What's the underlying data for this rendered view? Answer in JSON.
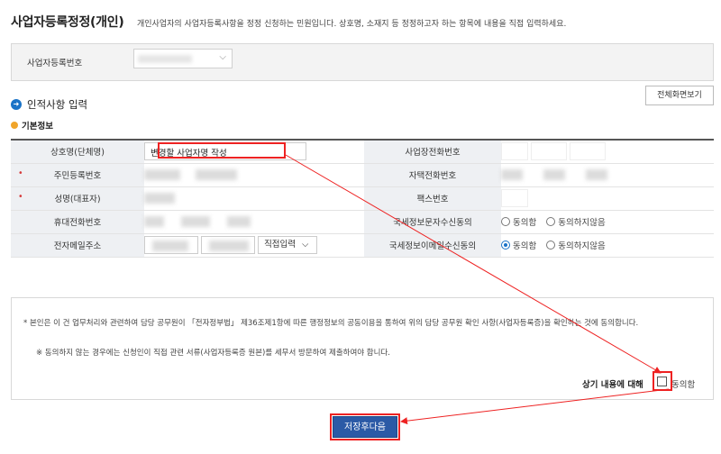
{
  "header": {
    "title": "사업자등록정정(개인)",
    "subtitle": "개인사업자의 사업자등록사항을 정정 신청하는 민원입니다. 상호명, 소재지 등 정정하고자 하는 항목에 내용을 직접 입력하세요."
  },
  "business": {
    "label": "사업자등록번호"
  },
  "section": {
    "title": "인적사항 입력",
    "full_view_label": "전체화면보기",
    "basic_info_label": "기본정보"
  },
  "form": {
    "company_name_label": "상호명(단체명)",
    "company_name_value": "변경할 사업자명 작성",
    "resident_no_label": "주민등록번호",
    "representative_label": "성명(대표자)",
    "mobile_label": "휴대전화번호",
    "email_label": "전자메일주소",
    "email_select_value": "직접입력",
    "office_phone_label": "사업장전화번호",
    "home_phone_label": "자택전화번호",
    "fax_label": "팩스번호",
    "sms_consent_label": "국세정보문자수신동의",
    "email_consent_label": "국세정보이메일수신동의",
    "agree_option": "동의함",
    "disagree_option": "동의하지않음",
    "sms_consent_selected": "none",
    "email_consent_selected": "동의함"
  },
  "consent": {
    "text1": "* 본인은 이 건 업무처리와 관련하여 담당 공무원이 「전자정부법」 제36조제1항에 따른 행정정보의 공동이용을 통하여 위의 담당 공무원 확인 사항(사업자등록증)을 확인하는 것에 동의합니다.",
    "text2": "※ 동의하지 않는 경우에는 신청인이 직접 관련 서류(사업자등록증 원본)를 세무서 방문하여 제출하여야 합니다.",
    "question": "상기 내용에 대해",
    "agree_label": "동의함"
  },
  "actions": {
    "save_next_label": "저장후다음"
  },
  "colors": {
    "accent": "#2b5aa6",
    "highlight": "#e22222",
    "required": "#d63b3b"
  }
}
